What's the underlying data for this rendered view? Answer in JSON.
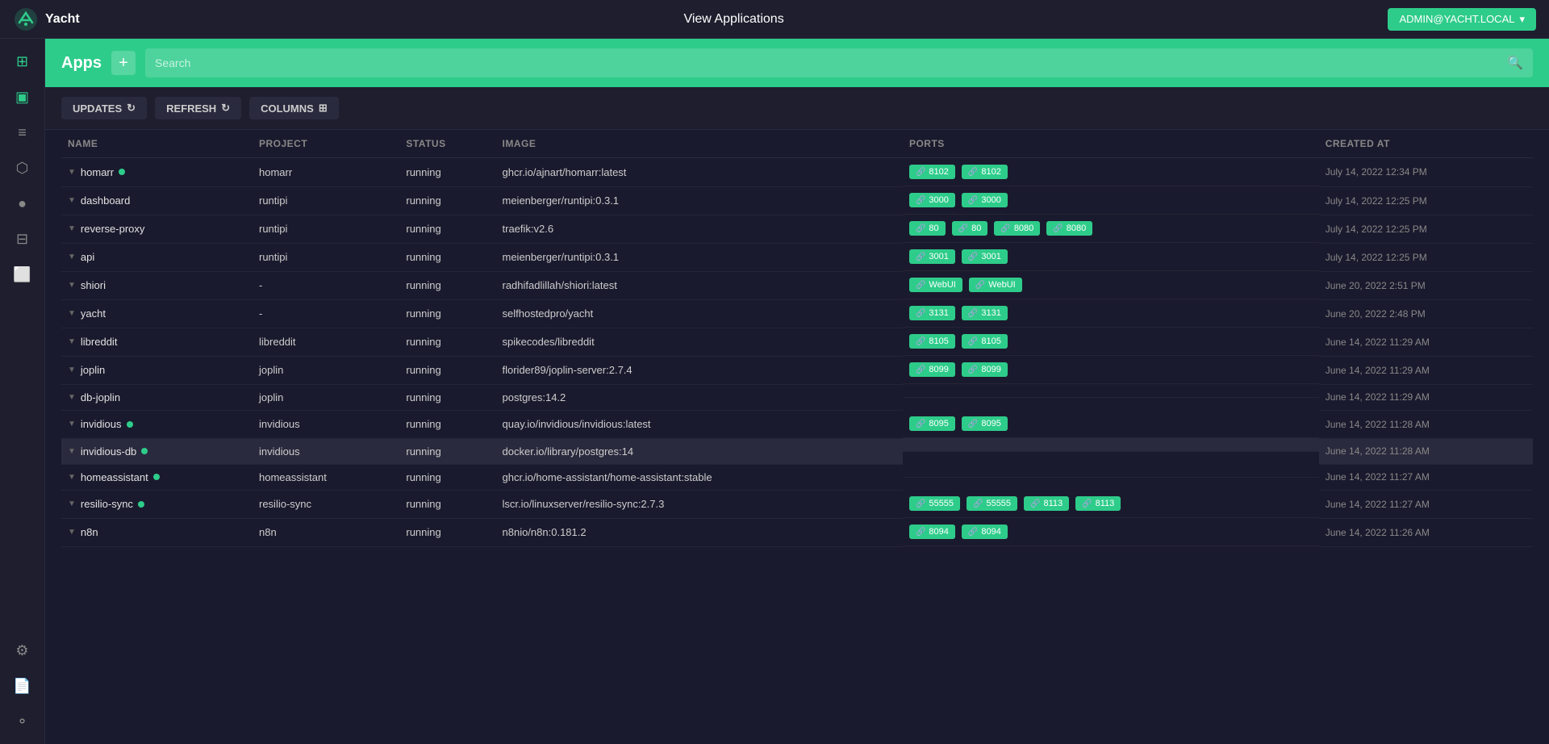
{
  "navbar": {
    "brand": "Yacht",
    "title": "View Applications",
    "user_label": "ADMIN@YACHT.LOCAL",
    "user_dropdown_icon": "▾"
  },
  "sidebar": {
    "icons": [
      {
        "name": "dashboard-icon",
        "symbol": "⊞",
        "active": false
      },
      {
        "name": "apps-icon",
        "symbol": "▣",
        "active": true
      },
      {
        "name": "templates-icon",
        "symbol": "≡",
        "active": false
      },
      {
        "name": "packages-icon",
        "symbol": "⬡",
        "active": false
      },
      {
        "name": "users-icon",
        "symbol": "●",
        "active": false
      },
      {
        "name": "resources-icon",
        "symbol": "⊟",
        "active": false
      },
      {
        "name": "monitor-icon",
        "symbol": "⬜",
        "active": false
      }
    ],
    "bottom_icons": [
      {
        "name": "settings-icon",
        "symbol": "⚙"
      },
      {
        "name": "docs-icon",
        "symbol": "📄"
      },
      {
        "name": "github-icon",
        "symbol": "⚬"
      }
    ]
  },
  "apps_header": {
    "title": "Apps",
    "add_label": "+",
    "search_placeholder": "Search"
  },
  "toolbar": {
    "updates_label": "UPDATES",
    "updates_icon": "↻",
    "refresh_label": "REFRESH",
    "refresh_icon": "↻",
    "columns_label": "COLUMNS",
    "columns_icon": "⊞"
  },
  "table": {
    "columns": [
      "Name",
      "Project",
      "Status",
      "Image",
      "Ports",
      "Created At"
    ],
    "rows": [
      {
        "name": "homarr",
        "has_dot": true,
        "dot_type": "green",
        "project": "homarr",
        "status": "running",
        "image": "ghcr.io/ajnart/homarr:latest",
        "ports": [
          {
            "label": "8102"
          },
          {
            "label": "8102"
          }
        ],
        "created": "July 14, 2022 12:34 PM",
        "highlighted": false
      },
      {
        "name": "dashboard",
        "has_dot": false,
        "dot_type": "",
        "project": "runtipi",
        "status": "running",
        "image": "meienberger/runtipi:0.3.1",
        "ports": [
          {
            "label": "3000"
          },
          {
            "label": "3000"
          }
        ],
        "created": "July 14, 2022 12:25 PM",
        "highlighted": false
      },
      {
        "name": "reverse-proxy",
        "has_dot": false,
        "dot_type": "",
        "project": "runtipi",
        "status": "running",
        "image": "traefik:v2.6",
        "ports": [
          {
            "label": "80"
          },
          {
            "label": "80"
          },
          {
            "label": "8080"
          },
          {
            "label": "8080"
          }
        ],
        "created": "July 14, 2022 12:25 PM",
        "highlighted": false
      },
      {
        "name": "api",
        "has_dot": false,
        "dot_type": "",
        "project": "runtipi",
        "status": "running",
        "image": "meienberger/runtipi:0.3.1",
        "ports": [
          {
            "label": "3001"
          },
          {
            "label": "3001"
          }
        ],
        "created": "July 14, 2022 12:25 PM",
        "highlighted": false
      },
      {
        "name": "shiori",
        "has_dot": false,
        "dot_type": "",
        "project": "-",
        "status": "running",
        "image": "radhifadlillah/shiori:latest",
        "ports": [
          {
            "label": "WebUI"
          },
          {
            "label": "WebUI"
          }
        ],
        "created": "June 20, 2022 2:51 PM",
        "highlighted": false
      },
      {
        "name": "yacht",
        "has_dot": false,
        "dot_type": "",
        "project": "-",
        "status": "running",
        "image": "selfhostedpro/yacht",
        "ports": [
          {
            "label": "3131"
          },
          {
            "label": "3131"
          }
        ],
        "created": "June 20, 2022 2:48 PM",
        "highlighted": false
      },
      {
        "name": "libreddit",
        "has_dot": false,
        "dot_type": "",
        "project": "libreddit",
        "status": "running",
        "image": "spikecodes/libreddit",
        "ports": [
          {
            "label": "8105"
          },
          {
            "label": "8105"
          }
        ],
        "created": "June 14, 2022 11:29 AM",
        "highlighted": false
      },
      {
        "name": "joplin",
        "has_dot": false,
        "dot_type": "",
        "project": "joplin",
        "status": "running",
        "image": "florider89/joplin-server:2.7.4",
        "ports": [
          {
            "label": "8099"
          },
          {
            "label": "8099"
          }
        ],
        "created": "June 14, 2022 11:29 AM",
        "highlighted": false
      },
      {
        "name": "db-joplin",
        "has_dot": false,
        "dot_type": "",
        "project": "joplin",
        "status": "running",
        "image": "postgres:14.2",
        "ports": [],
        "created": "June 14, 2022 11:29 AM",
        "highlighted": false
      },
      {
        "name": "invidious",
        "has_dot": true,
        "dot_type": "green",
        "project": "invidious",
        "status": "running",
        "image": "quay.io/invidious/invidious:latest",
        "ports": [
          {
            "label": "8095"
          },
          {
            "label": "8095"
          }
        ],
        "created": "June 14, 2022 11:28 AM",
        "highlighted": false
      },
      {
        "name": "invidious-db",
        "has_dot": true,
        "dot_type": "green",
        "project": "invidious",
        "status": "running",
        "image": "docker.io/library/postgres:14",
        "ports": [],
        "created": "June 14, 2022 11:28 AM",
        "highlighted": true
      },
      {
        "name": "homeassistant",
        "has_dot": true,
        "dot_type": "green",
        "project": "homeassistant",
        "status": "running",
        "image": "ghcr.io/home-assistant/home-assistant:stable",
        "ports": [],
        "created": "June 14, 2022 11:27 AM",
        "highlighted": false
      },
      {
        "name": "resilio-sync",
        "has_dot": true,
        "dot_type": "green",
        "project": "resilio-sync",
        "status": "running",
        "image": "lscr.io/linuxserver/resilio-sync:2.7.3",
        "ports": [
          {
            "label": "55555"
          },
          {
            "label": "55555"
          },
          {
            "label": "8113"
          },
          {
            "label": "8113"
          }
        ],
        "created": "June 14, 2022 11:27 AM",
        "highlighted": false
      },
      {
        "name": "n8n",
        "has_dot": false,
        "dot_type": "",
        "project": "n8n",
        "status": "running",
        "image": "n8nio/n8n:0.181.2",
        "ports": [
          {
            "label": "8094"
          },
          {
            "label": "8094"
          }
        ],
        "created": "June 14, 2022 11:26 AM",
        "highlighted": false
      }
    ]
  }
}
